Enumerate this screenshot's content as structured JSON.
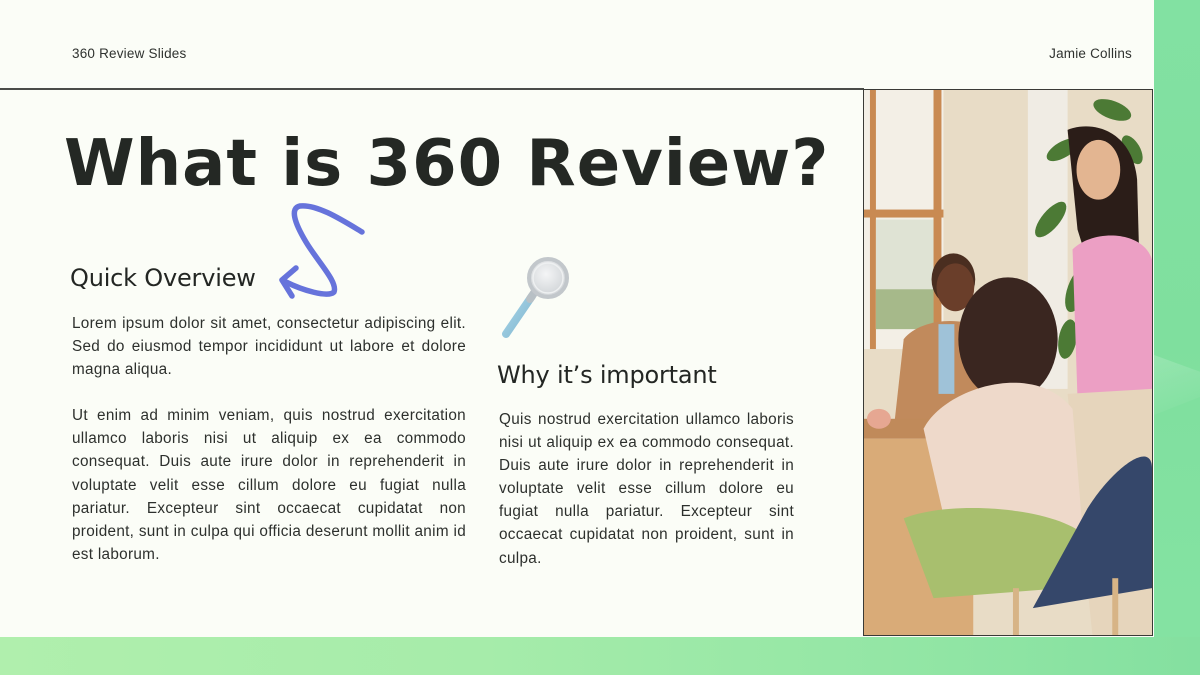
{
  "header": {
    "deck_title": "360 Review Slides",
    "author": "Jamie Collins"
  },
  "slide": {
    "title": "What is 360 Review?",
    "sections": [
      {
        "heading": "Quick Overview",
        "paragraphs": [
          "Lorem ipsum dolor sit amet, consectetur adipiscing elit. Sed do eiusmod tempor incididunt ut labore et dolore magna aliqua.",
          "Ut enim ad minim veniam, quis nostrud exercitation ullamco laboris nisi ut aliquip ex ea commodo consequat. Duis aute irure dolor in reprehenderit in voluptate velit esse cillum dolore eu fugiat nulla pariatur. Excepteur sint occaecat cupidatat non proident, sunt in culpa qui officia deserunt mollit anim id est laborum."
        ]
      },
      {
        "heading": "Why it’s important",
        "paragraphs": [
          "Quis nostrud exercitation ullamco laboris nisi ut aliquip ex ea commodo consequat. Duis aute irure dolor in reprehenderit in voluptate velit esse cillum dolore eu fugiat nulla pariatur. Excepteur sint occaecat cupidatat non proident, sunt in culpa."
        ]
      }
    ],
    "decorations": {
      "squiggle_arrow": "squiggle-arrow-icon",
      "magnifier": "magnifying-glass-icon",
      "photo": "team-meeting-photo"
    }
  },
  "colors": {
    "background": "#fbfdf7",
    "text": "#232623",
    "accent_green": "#82e1a2",
    "accent_green_light": "#b0efad",
    "squiggle_blue": "#6673db",
    "magnifier_handle": "#8fc4dc"
  }
}
